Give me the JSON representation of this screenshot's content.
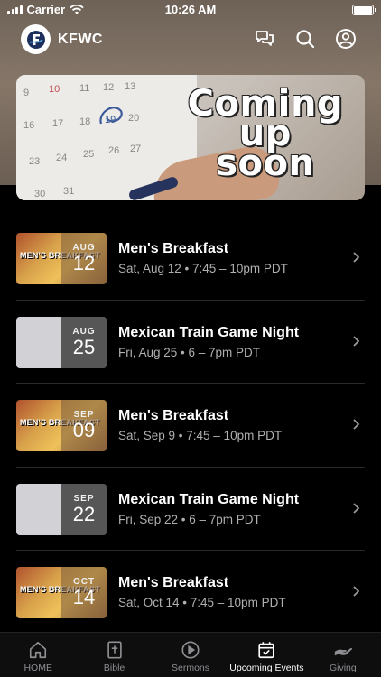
{
  "status_bar": {
    "carrier": "Carrier",
    "time": "10:26 AM"
  },
  "header": {
    "title": "KFWC",
    "icons": [
      "chat-bubbles-icon",
      "search-icon",
      "profile-icon"
    ]
  },
  "banner": {
    "lines": [
      "Coming",
      "up",
      "soon"
    ]
  },
  "events": [
    {
      "title": "Men's Breakfast",
      "subtitle": "Sat, Aug 12 • 7:45 – 10pm PDT",
      "month": "AUG",
      "day": "12",
      "thumb": "food",
      "thumb_label": "MEN'S BREAKFAST"
    },
    {
      "title": "Mexican Train Game Night",
      "subtitle": "Fri, Aug 25 • 6 – 7pm PDT",
      "month": "AUG",
      "day": "25",
      "thumb": "plain",
      "thumb_label": ""
    },
    {
      "title": "Men's Breakfast",
      "subtitle": "Sat, Sep 9 • 7:45 – 10pm PDT",
      "month": "SEP",
      "day": "09",
      "thumb": "food",
      "thumb_label": "MEN'S BREAKFAST"
    },
    {
      "title": "Mexican Train Game Night",
      "subtitle": "Fri, Sep 22 • 6 – 7pm PDT",
      "month": "SEP",
      "day": "22",
      "thumb": "plain",
      "thumb_label": ""
    },
    {
      "title": "Men's Breakfast",
      "subtitle": "Sat, Oct 14 • 7:45 – 10pm PDT",
      "month": "OCT",
      "day": "14",
      "thumb": "food",
      "thumb_label": "MEN'S BREAKFAST"
    }
  ],
  "tabs": [
    {
      "label": "HOME",
      "icon": "home-icon",
      "active": false
    },
    {
      "label": "Bible",
      "icon": "bible-icon",
      "active": false
    },
    {
      "label": "Sermons",
      "icon": "play-icon",
      "active": false
    },
    {
      "label": "Upcoming Events",
      "icon": "calendar-icon",
      "active": true
    },
    {
      "label": "Giving",
      "icon": "giving-hand-icon",
      "active": false
    }
  ],
  "colors": {
    "background": "#000000",
    "header": "#857668",
    "muted_text": "#b0b0b0",
    "tab_inactive": "#8e8e93"
  }
}
